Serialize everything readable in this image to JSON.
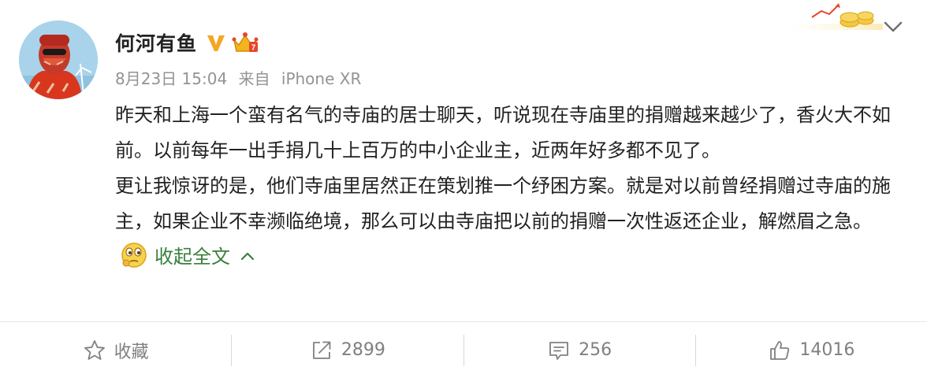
{
  "post": {
    "username": "何河有鱼",
    "date": "8月23日 15:04",
    "source_prefix": "来自",
    "source_device": "iPhone XR",
    "paragraph1": "昨天和上海一个蛮有名气的寺庙的居士聊天，听说现在寺庙里的捐赠越来越少了，香火大不如前。以前每年一出手捐几十上百万的中小企业主，近两年好多都不见了。",
    "paragraph2": "更让我惊讶的是，他们寺庙里居然正在策划推一个纾困方案。就是对以前曾经捐赠过寺庙的施主，如果企业不幸濒临绝境，那么可以由寺庙把以前的捐赠一次性返还企业，解燃眉之急。",
    "collapse_label": "收起全文"
  },
  "actions": {
    "favorite_label": "收藏",
    "repost_count": "2899",
    "comment_count": "256",
    "like_count": "14016"
  },
  "colors": {
    "link_green": "#3a7f3e",
    "meta_gray": "#939393",
    "vbadge_orange": "#f5a623"
  },
  "icons": [
    "vip-v-badge-icon",
    "crown-badge-icon",
    "chevron-down-icon",
    "thinking-emoji-icon",
    "chevron-up-icon",
    "star-icon",
    "share-icon",
    "comment-icon",
    "thumbs-up-icon"
  ]
}
